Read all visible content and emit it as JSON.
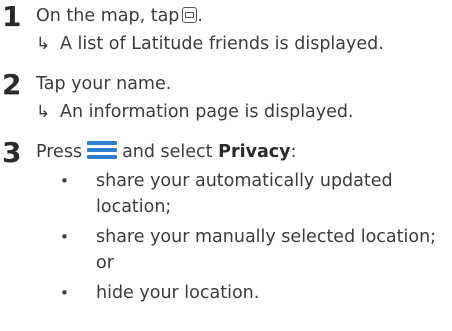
{
  "steps": [
    {
      "number": "1",
      "text_before": "On the map, tap",
      "icon": "list-view-icon",
      "text_after": ".",
      "result": "A list of Latitude friends is displayed."
    },
    {
      "number": "2",
      "text": "Tap your name.",
      "result": "An information page is displayed."
    },
    {
      "number": "3",
      "text_press": "Press",
      "icon": "menu-icon",
      "text_select": "and select",
      "bold_option": "Privacy",
      "colon": ":",
      "bullets": [
        "share your automatically updated",
        "location;",
        "share your manually selected location;",
        "or",
        "hide your location."
      ]
    }
  ],
  "glyphs": {
    "arrow": "↳",
    "bullet": "•"
  },
  "colors": {
    "text": "#3c3c3c",
    "heading_number": "#2a2a2a",
    "menu_icon": "#2d7fd0"
  }
}
